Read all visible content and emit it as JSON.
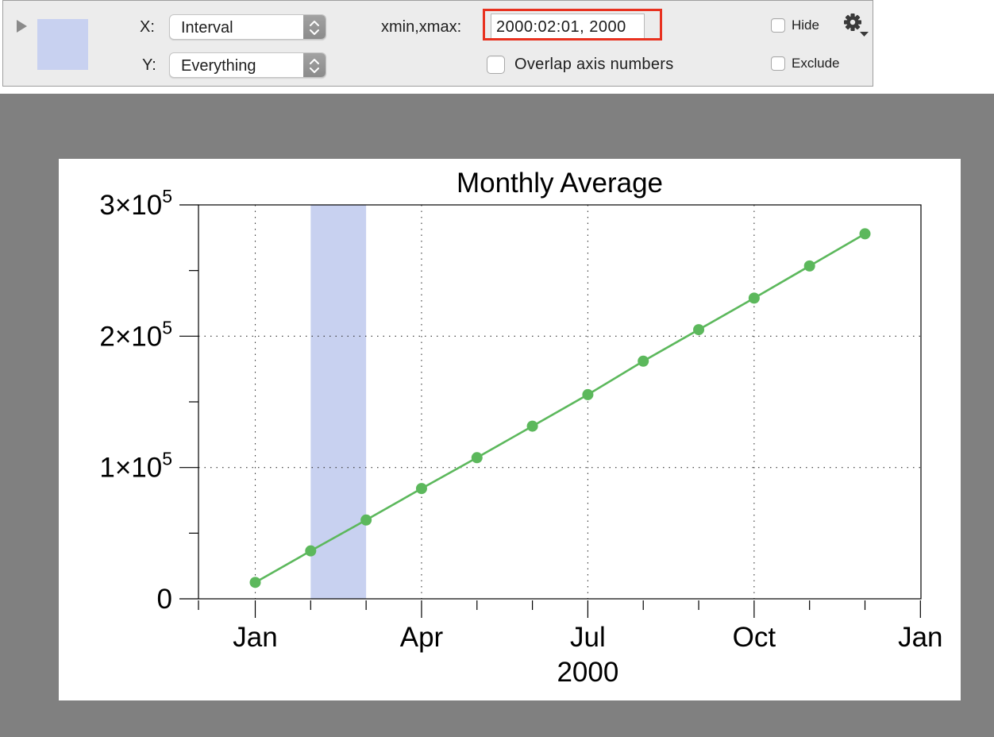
{
  "panel": {
    "x_label": "X:",
    "x_value": "Interval",
    "y_label": "Y:",
    "y_value": "Everything",
    "range_label": "xmin,xmax:",
    "range_value": "2000:02:01, 2000",
    "overlap_label": "Overlap axis numbers",
    "overlap_checked": false,
    "hide_label": "Hide",
    "hide_checked": false,
    "exclude_label": "Exclude",
    "exclude_checked": false,
    "swatch_color": "#c8d1f0",
    "highlight_color": "#e8311f",
    "settings_icon": "gear-icon"
  },
  "chart_data": {
    "type": "line",
    "title": "Monthly Average",
    "xlabel": "2000",
    "ylabel": "",
    "x": [
      "2000-01",
      "2000-02",
      "2000-03",
      "2000-04",
      "2000-05",
      "2000-06",
      "2000-07",
      "2000-08",
      "2000-09",
      "2000-10",
      "2000-11",
      "2000-12"
    ],
    "series": [
      {
        "color": "#5cb85c",
        "values": [
          12500,
          36500,
          60000,
          84000,
          107500,
          131500,
          155500,
          181000,
          205000,
          229000,
          253500,
          278000
        ]
      }
    ],
    "x_tick_labels": [
      "Jan",
      "Apr",
      "Jul",
      "Oct",
      "Jan"
    ],
    "y_tick_labels": [
      {
        "base": "0",
        "exp": ""
      },
      {
        "base": "1×10",
        "exp": "5"
      },
      {
        "base": "2×10",
        "exp": "5"
      },
      {
        "base": "3×10",
        "exp": "5"
      }
    ],
    "ylim": [
      0,
      300000
    ],
    "xlim": [
      "2000-01",
      "2001-01"
    ],
    "grid": true,
    "highlight_interval": [
      "2000-02",
      "2000-03"
    ],
    "highlight_color": "#c8d1f0"
  }
}
